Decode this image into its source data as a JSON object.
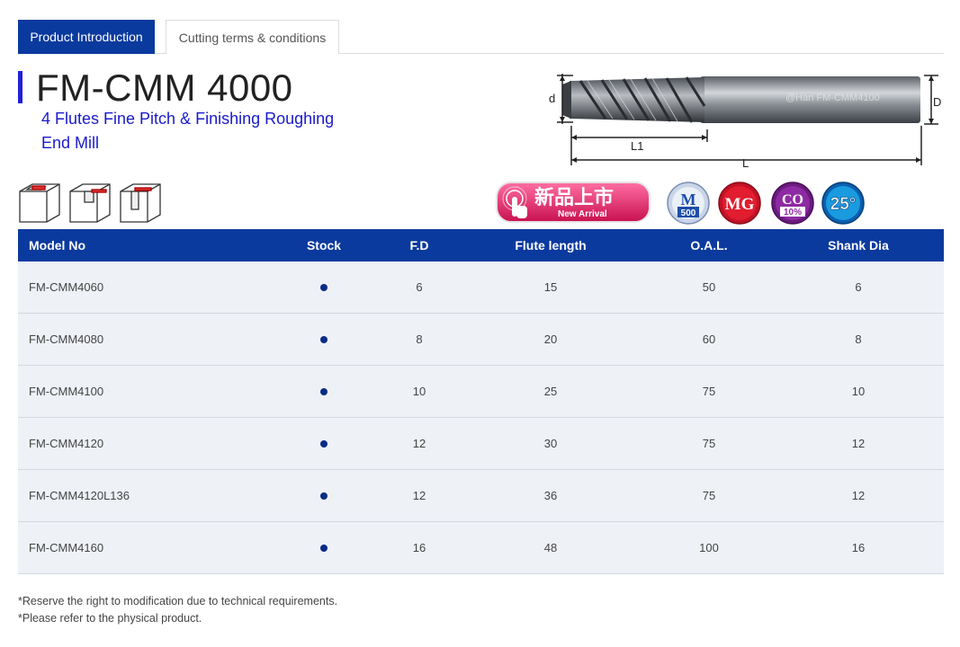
{
  "tabs": [
    {
      "label": "Product Introduction",
      "active": true
    },
    {
      "label": "Cutting terms & conditions",
      "active": false
    }
  ],
  "product": {
    "title": "FM-CMM 4000",
    "subtitle_line1": "4 Flutes Fine Pitch & Finishing Roughing",
    "subtitle_line2": "End Mill"
  },
  "diagram": {
    "label_d": "d",
    "label_D": "D",
    "label_L1": "L1",
    "label_L": "L",
    "tool_marking": "@Han FM-CMM4100"
  },
  "badges": {
    "new_cn": "新品上市",
    "new_en": "New Arrival",
    "m500_top": "M",
    "m500_bottom": "500",
    "mg": "MG",
    "co_top": "CO",
    "co_bottom": "10%",
    "angle": "25°"
  },
  "table": {
    "headers": [
      "Model No",
      "Stock",
      "F.D",
      "Flute length",
      "O.A.L.",
      "Shank Dia"
    ],
    "rows": [
      {
        "model": "FM-CMM4060",
        "stock": true,
        "fd": "6",
        "flute": "15",
        "oal": "50",
        "shank": "6"
      },
      {
        "model": "FM-CMM4080",
        "stock": true,
        "fd": "8",
        "flute": "20",
        "oal": "60",
        "shank": "8"
      },
      {
        "model": "FM-CMM4100",
        "stock": true,
        "fd": "10",
        "flute": "25",
        "oal": "75",
        "shank": "10"
      },
      {
        "model": "FM-CMM4120",
        "stock": true,
        "fd": "12",
        "flute": "30",
        "oal": "75",
        "shank": "12"
      },
      {
        "model": "FM-CMM4120L136",
        "stock": true,
        "fd": "12",
        "flute": "36",
        "oal": "75",
        "shank": "12"
      },
      {
        "model": "FM-CMM4160",
        "stock": true,
        "fd": "16",
        "flute": "48",
        "oal": "100",
        "shank": "16"
      }
    ]
  },
  "notes": [
    "*Reserve the right to modification due to technical requirements.",
    "*Please refer to the physical product."
  ],
  "colors": {
    "brand_blue": "#0b3a9e",
    "subtitle_blue": "#1a1acc",
    "stock_dot": "#0b2c86",
    "row_bg": "#eef1f6"
  }
}
